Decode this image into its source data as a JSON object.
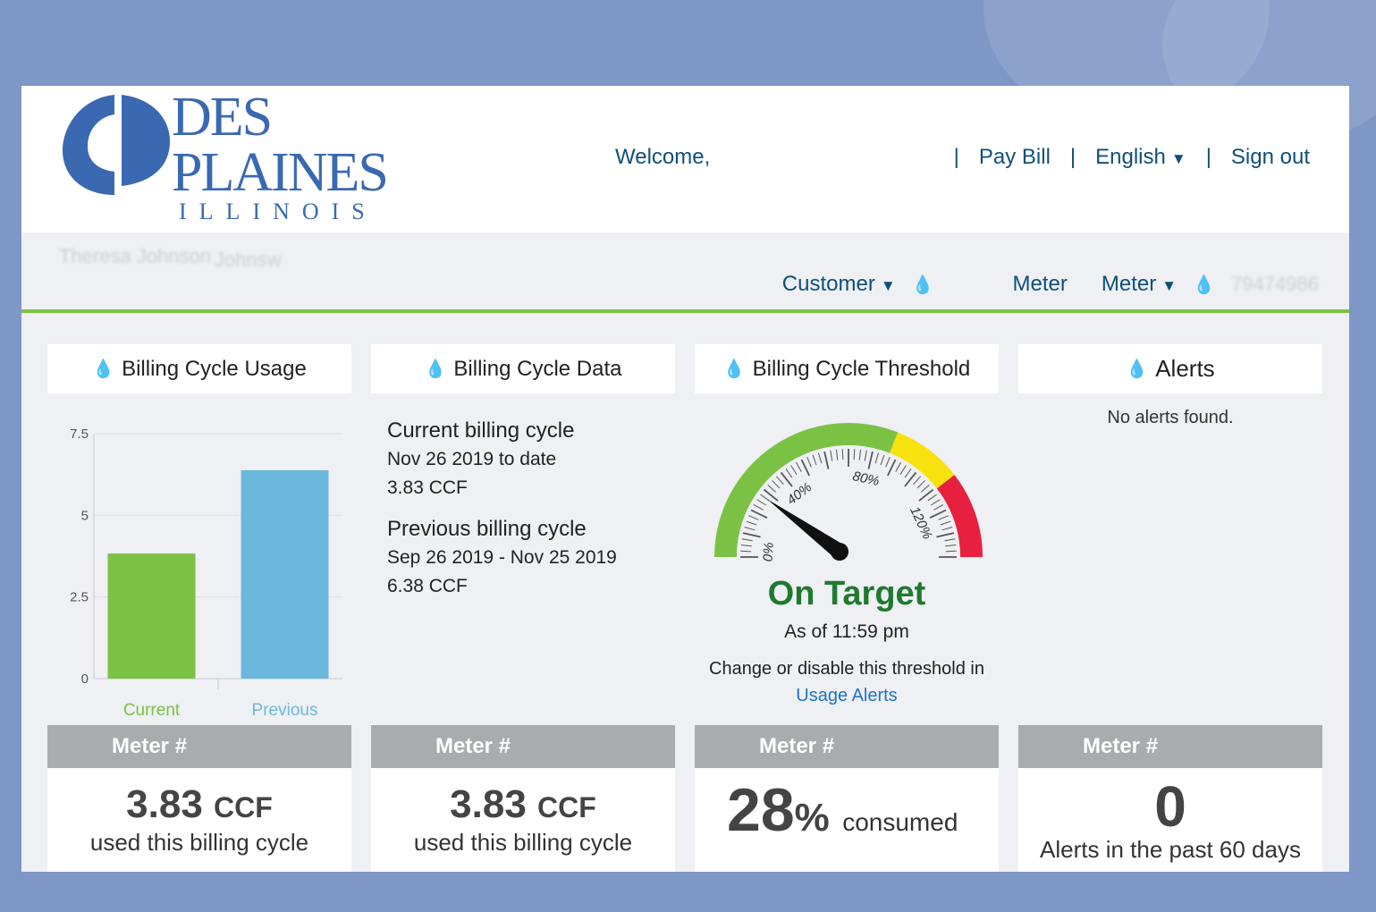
{
  "header": {
    "logo_line1": "DES",
    "logo_line2": "PLAINES",
    "logo_line3": "ILLINOIS",
    "welcome": "Welcome,",
    "nav": {
      "sep": "|",
      "pay_bill": "Pay Bill",
      "language": "English",
      "sign_out": "Sign out",
      "caret": "▼"
    }
  },
  "subbar": {
    "blur_name": "Theresa Johnson",
    "blur_addr": "Johnsw",
    "customer": "Customer",
    "meter_label": "Meter",
    "meter_dropdown": "Meter",
    "drop": "💧",
    "blur_meter": "79474986"
  },
  "panels": {
    "usage": {
      "title": "Billing Cycle Usage",
      "meter": "Meter #",
      "value": "3.83",
      "unit": "CCF",
      "sub": "used this billing cycle"
    },
    "data": {
      "title": "Billing Cycle Data",
      "current_hd": "Current billing cycle",
      "current_range": "Nov 26 2019 to date",
      "current_val": "3.83 CCF",
      "prev_hd": "Previous billing cycle",
      "prev_range": "Sep 26 2019 - Nov 25 2019",
      "prev_val": "6.38 CCF",
      "meter": "Meter #",
      "value": "3.83",
      "unit": "CCF",
      "sub": "used this billing cycle"
    },
    "threshold": {
      "title": "Billing Cycle Threshold",
      "status": "On Target",
      "asof": "As of 11:59 pm",
      "change": "Change or disable this threshold in",
      "link": "Usage Alerts",
      "meter": "Meter #",
      "pct": "28",
      "pct_sign": "%",
      "consumed": "consumed",
      "ticks": [
        "0%",
        "40%",
        "80%",
        "120%"
      ]
    },
    "alerts": {
      "title": "Alerts",
      "none": "No alerts found.",
      "meter": "Meter #",
      "count": "0",
      "sub": "Alerts in the past 60 days"
    }
  },
  "colors": {
    "green": "#7bc244",
    "blue": "#6ab8dd",
    "yellow": "#f7e10f",
    "red": "#e8203f"
  },
  "chart_data": {
    "type": "bar",
    "categories": [
      "Current",
      "Previous"
    ],
    "values": [
      3.83,
      6.38
    ],
    "ylim": [
      0,
      7.5
    ],
    "yticks": [
      "0",
      "2.5",
      "5",
      "7.5"
    ],
    "grid": true
  },
  "gauge": {
    "value": 28,
    "max": 140
  }
}
